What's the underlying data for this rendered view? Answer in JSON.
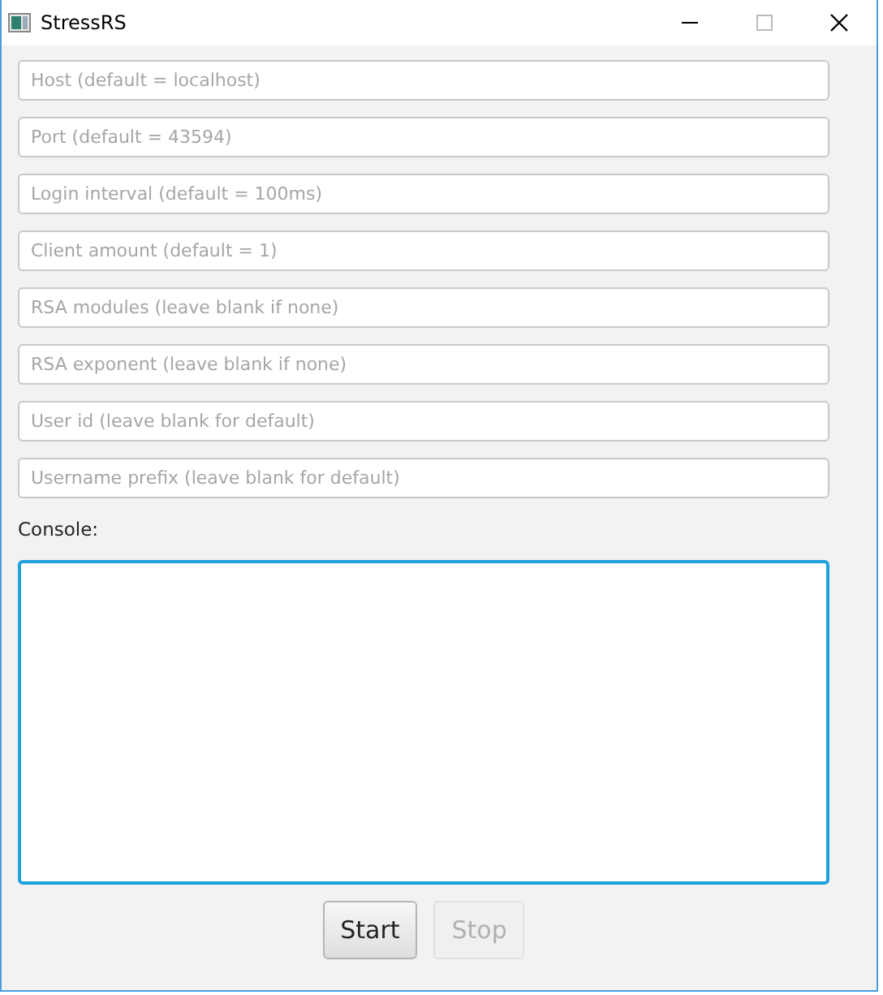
{
  "window": {
    "title": "StressRS"
  },
  "fields": [
    {
      "placeholder": "Host (default = localhost)"
    },
    {
      "placeholder": "Port (default = 43594)"
    },
    {
      "placeholder": "Login interval (default = 100ms)"
    },
    {
      "placeholder": "Client amount (default = 1)"
    },
    {
      "placeholder": "RSA modules (leave blank if none)"
    },
    {
      "placeholder": "RSA exponent (leave blank if none)"
    },
    {
      "placeholder": "User id (leave blank for default)"
    },
    {
      "placeholder": "Username prefix (leave blank for default)"
    }
  ],
  "console": {
    "label": "Console:",
    "focused": true
  },
  "buttons": [
    {
      "label": "Start",
      "disabled": false
    },
    {
      "label": "Stop",
      "disabled": true
    }
  ]
}
